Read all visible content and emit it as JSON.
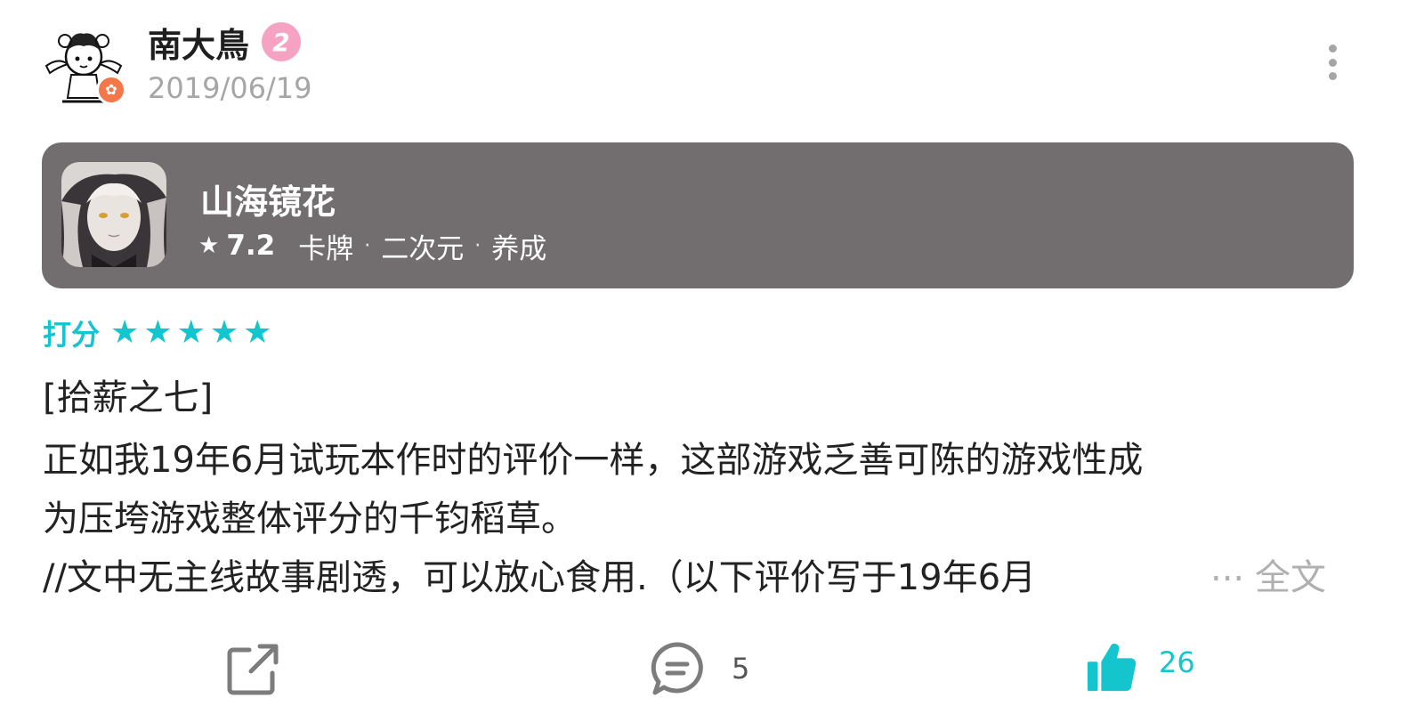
{
  "user": {
    "name": "南大鳥",
    "level": "2",
    "date": "2019/06/19"
  },
  "game": {
    "title": "山海镜花",
    "score": "7.2",
    "tags": [
      "卡牌",
      "二次元",
      "养成"
    ]
  },
  "rating": {
    "label": "打分",
    "stars": 5
  },
  "review": {
    "title": "[拾薪之七]",
    "lines": [
      "正如我19年6月试玩本作时的评价一样，这部游戏乏善可陈的游戏性成",
      "为压垮游戏整体评分的千钧稻草。",
      "//文中无主线故事剧透，可以放心食用.（以下评价写于19年6月"
    ],
    "ellipsis": "...",
    "more_label": "全文"
  },
  "actions": {
    "comment_count": "5",
    "like_count": "26"
  },
  "colors": {
    "accent": "#15c5ce",
    "card_bg": "#726e6f",
    "level_badge": "#f6a3c3",
    "verified_badge": "#f2784b",
    "muted": "#a6a6a6"
  },
  "icons": {
    "more": "vertical-dots-icon",
    "share": "share-external-icon",
    "comment": "comment-bubble-icon",
    "like": "thumbs-up-icon",
    "star": "star-icon"
  }
}
